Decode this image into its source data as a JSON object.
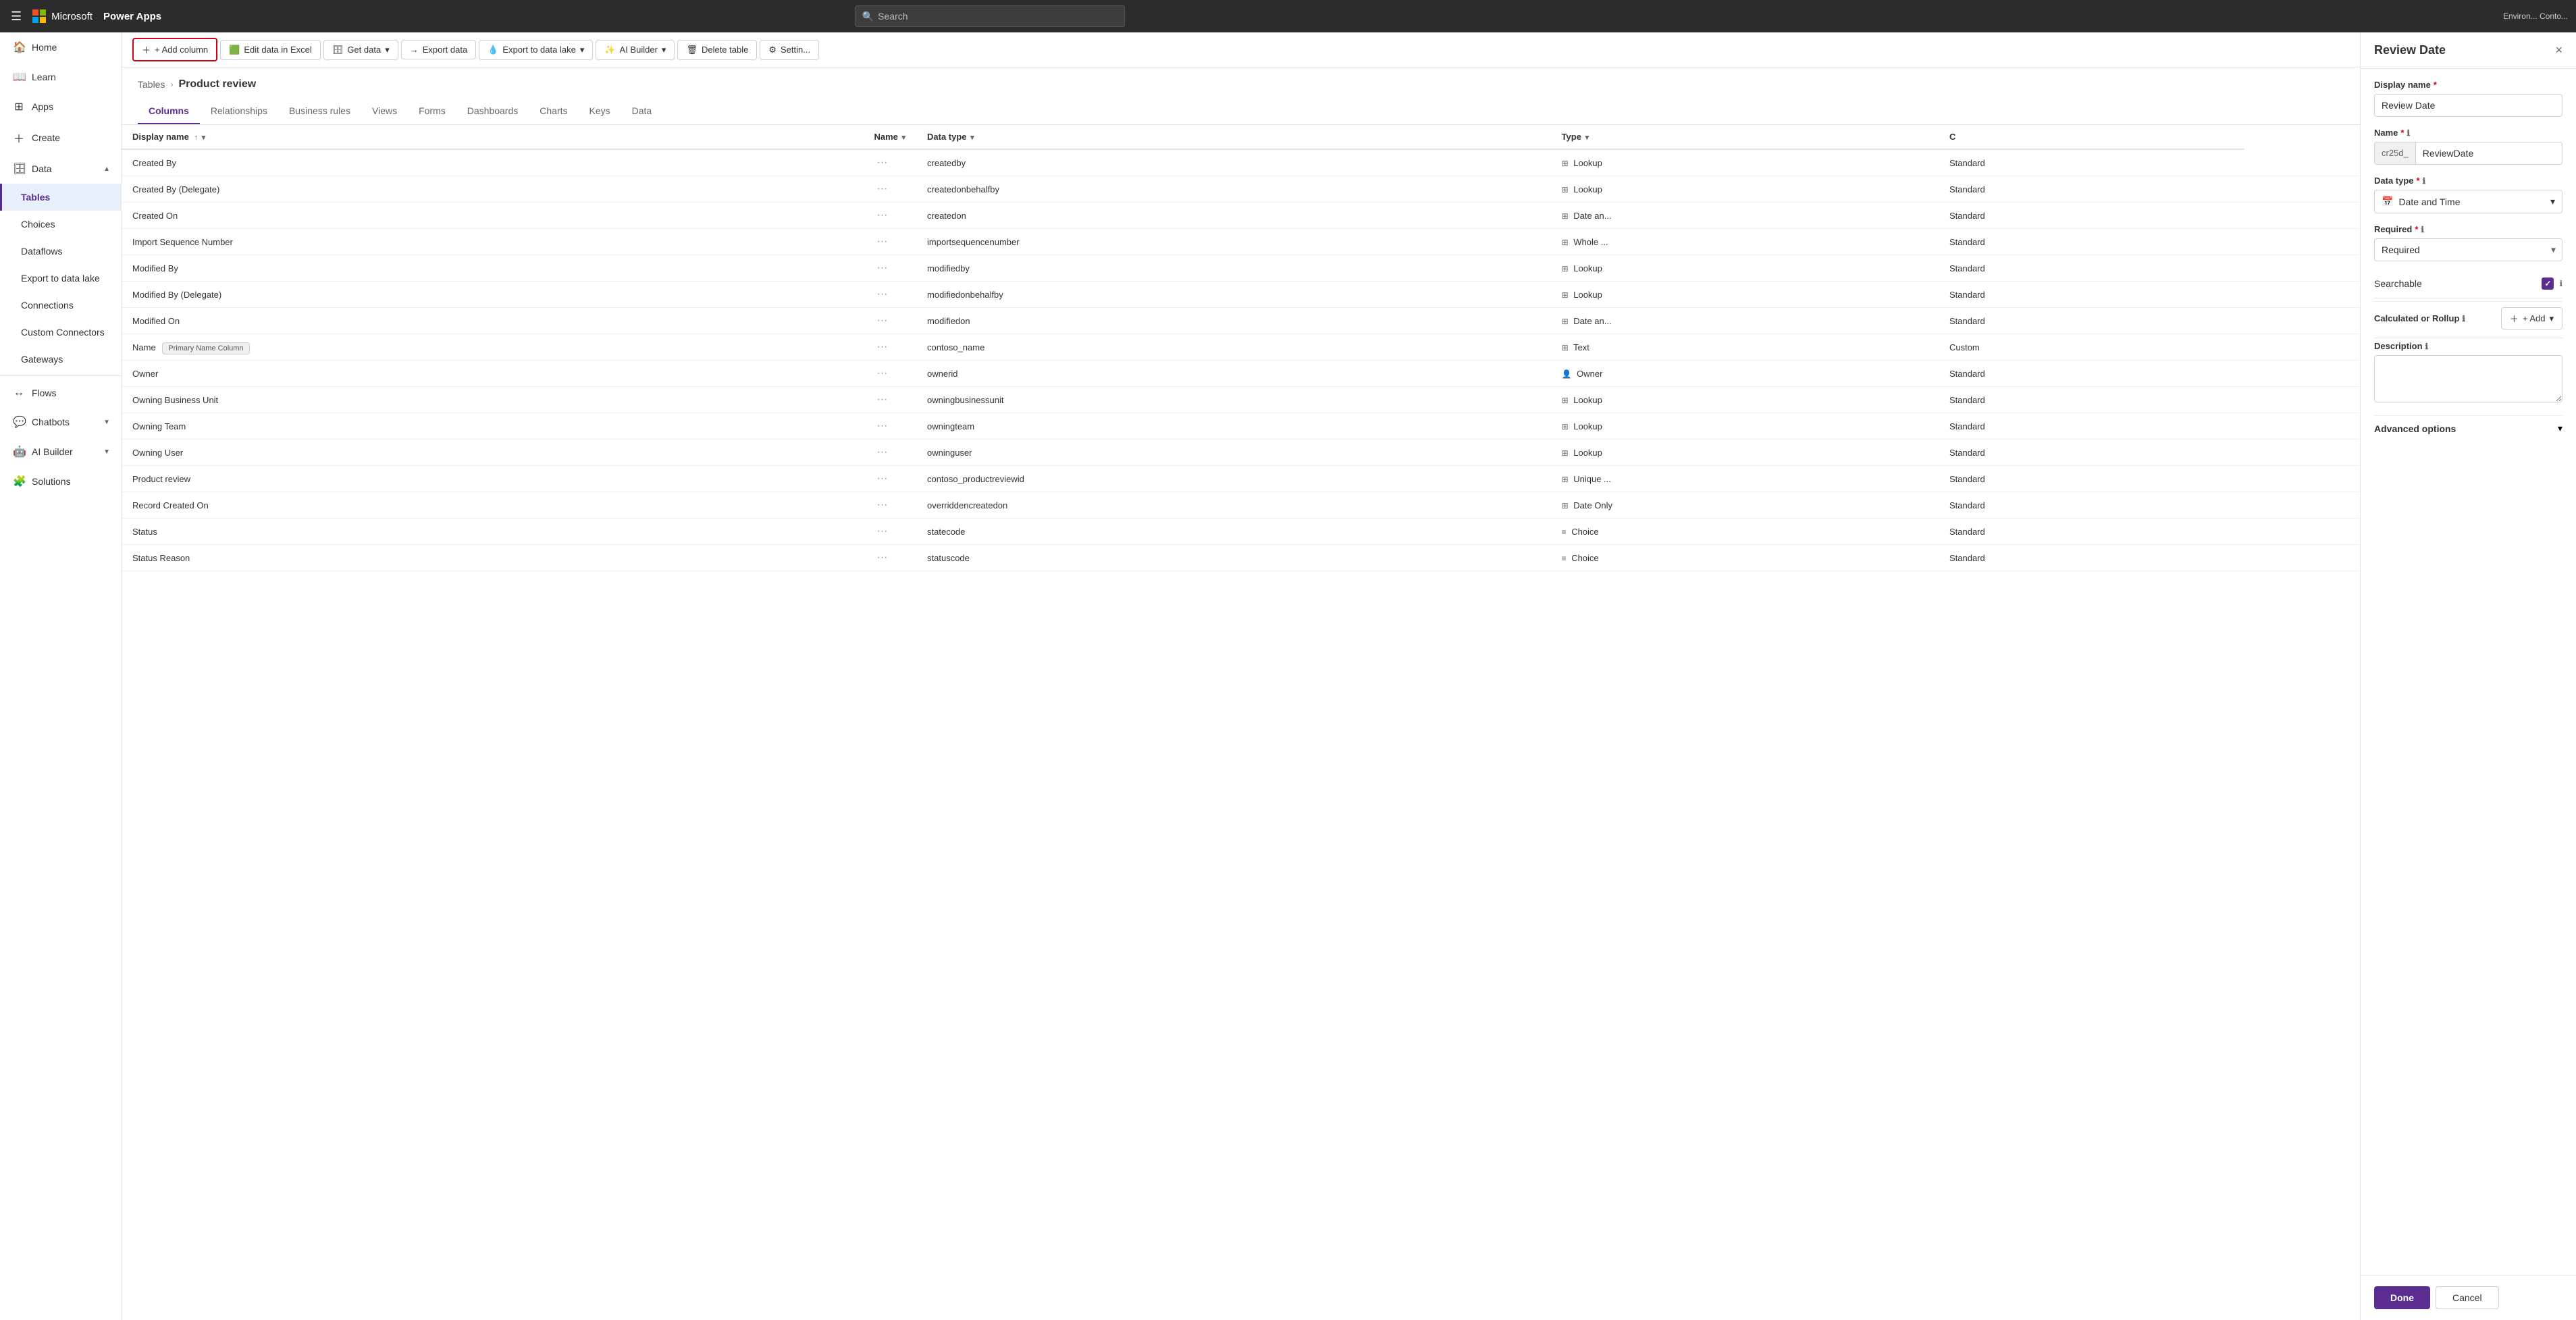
{
  "topNav": {
    "appName": "Power Apps",
    "searchPlaceholder": "Search",
    "envLabel": "Environ... Conto..."
  },
  "sidebar": {
    "items": [
      {
        "id": "home",
        "label": "Home",
        "icon": "🏠",
        "active": false
      },
      {
        "id": "learn",
        "label": "Learn",
        "icon": "📖",
        "active": false
      },
      {
        "id": "apps",
        "label": "Apps",
        "icon": "⊞",
        "active": false
      },
      {
        "id": "create",
        "label": "Create",
        "icon": "+",
        "active": false
      },
      {
        "id": "data",
        "label": "Data",
        "icon": "🗄",
        "active": false,
        "expanded": true
      },
      {
        "id": "tables",
        "label": "Tables",
        "icon": "",
        "active": true,
        "sub": true
      },
      {
        "id": "choices",
        "label": "Choices",
        "icon": "",
        "active": false,
        "sub": true
      },
      {
        "id": "dataflows",
        "label": "Dataflows",
        "icon": "",
        "active": false,
        "sub": true
      },
      {
        "id": "export",
        "label": "Export to data lake",
        "icon": "",
        "active": false,
        "sub": true
      },
      {
        "id": "connections",
        "label": "Connections",
        "icon": "",
        "active": false,
        "sub": true
      },
      {
        "id": "connectors",
        "label": "Custom Connectors",
        "icon": "",
        "active": false,
        "sub": true
      },
      {
        "id": "gateways",
        "label": "Gateways",
        "icon": "",
        "active": false,
        "sub": true
      },
      {
        "id": "flows",
        "label": "Flows",
        "icon": "↔",
        "active": false
      },
      {
        "id": "chatbots",
        "label": "Chatbots",
        "icon": "💬",
        "active": false
      },
      {
        "id": "aibuilder",
        "label": "AI Builder",
        "icon": "🤖",
        "active": false
      },
      {
        "id": "solutions",
        "label": "Solutions",
        "icon": "🧩",
        "active": false
      }
    ]
  },
  "toolbar": {
    "addColumn": "+ Add column",
    "editExcel": "Edit data in Excel",
    "getData": "Get data",
    "exportData": "Export data",
    "exportLake": "Export to data lake",
    "aiBuilder": "AI Builder",
    "deleteTable": "Delete table",
    "settings": "Settin..."
  },
  "breadcrumb": {
    "tables": "Tables",
    "current": "Product review"
  },
  "tabs": [
    {
      "id": "columns",
      "label": "Columns",
      "active": true
    },
    {
      "id": "relationships",
      "label": "Relationships",
      "active": false
    },
    {
      "id": "businessrules",
      "label": "Business rules",
      "active": false
    },
    {
      "id": "views",
      "label": "Views",
      "active": false
    },
    {
      "id": "forms",
      "label": "Forms",
      "active": false
    },
    {
      "id": "dashboards",
      "label": "Dashboards",
      "active": false
    },
    {
      "id": "charts",
      "label": "Charts",
      "active": false
    },
    {
      "id": "keys",
      "label": "Keys",
      "active": false
    },
    {
      "id": "data",
      "label": "Data",
      "active": false
    }
  ],
  "tableColumns": {
    "headers": [
      "Display name",
      "Name",
      "Data type",
      "Type",
      "C"
    ],
    "rows": [
      {
        "displayName": "Created By",
        "dots": "···",
        "name": "createdby",
        "dataType": "Lookup",
        "type": "Standard",
        "dtIcon": "⊞"
      },
      {
        "displayName": "Created By (Delegate)",
        "dots": "···",
        "name": "createdonbehalfby",
        "dataType": "Lookup",
        "type": "Standard",
        "dtIcon": "⊞"
      },
      {
        "displayName": "Created On",
        "dots": "···",
        "name": "createdon",
        "dataType": "Date an...",
        "type": "Standard",
        "dtIcon": "⊞"
      },
      {
        "displayName": "Import Sequence Number",
        "dots": "···",
        "name": "importsequencenumber",
        "dataType": "Whole ...",
        "type": "Standard",
        "dtIcon": "⊞"
      },
      {
        "displayName": "Modified By",
        "dots": "···",
        "name": "modifiedby",
        "dataType": "Lookup",
        "type": "Standard",
        "dtIcon": "⊞"
      },
      {
        "displayName": "Modified By (Delegate)",
        "dots": "···",
        "name": "modifiedonbehalfby",
        "dataType": "Lookup",
        "type": "Standard",
        "dtIcon": "⊞"
      },
      {
        "displayName": "Modified On",
        "dots": "···",
        "name": "modifiedon",
        "dataType": "Date an...",
        "type": "Standard",
        "dtIcon": "⊞"
      },
      {
        "displayName": "Name",
        "dots": "···",
        "name": "contoso_name",
        "badge": "Primary Name Column",
        "dataType": "Text",
        "type": "Custom",
        "dtIcon": "⊞"
      },
      {
        "displayName": "Owner",
        "dots": "···",
        "name": "ownerid",
        "dataType": "Owner",
        "type": "Standard",
        "dtIcon": "👤"
      },
      {
        "displayName": "Owning Business Unit",
        "dots": "···",
        "name": "owningbusinessunit",
        "dataType": "Lookup",
        "type": "Standard",
        "dtIcon": "⊞"
      },
      {
        "displayName": "Owning Team",
        "dots": "···",
        "name": "owningteam",
        "dataType": "Lookup",
        "type": "Standard",
        "dtIcon": "⊞"
      },
      {
        "displayName": "Owning User",
        "dots": "···",
        "name": "owninguser",
        "dataType": "Lookup",
        "type": "Standard",
        "dtIcon": "⊞"
      },
      {
        "displayName": "Product review",
        "dots": "···",
        "name": "contoso_productreviewid",
        "dataType": "Unique ...",
        "type": "Standard",
        "dtIcon": "⊞"
      },
      {
        "displayName": "Record Created On",
        "dots": "···",
        "name": "overriddencreatedon",
        "dataType": "Date Only",
        "type": "Standard",
        "dtIcon": "⊞"
      },
      {
        "displayName": "Status",
        "dots": "···",
        "name": "statecode",
        "dataType": "Choice",
        "type": "Standard",
        "dtIcon": "≡"
      },
      {
        "displayName": "Status Reason",
        "dots": "···",
        "name": "statuscode",
        "dataType": "Choice",
        "type": "Standard",
        "dtIcon": "≡"
      }
    ]
  },
  "panel": {
    "title": "Review Date",
    "closeLabel": "×",
    "fields": {
      "displayNameLabel": "Display name",
      "displayNameValue": "Review Date",
      "nameLabel": "Name",
      "namePrefix": "cr25d_",
      "nameValue": "ReviewDate",
      "dataTypeLabel": "Data type",
      "dataTypeValue": "Date and Time",
      "dataTypeIcon": "📅",
      "requiredLabel": "Required",
      "requiredValue": "Required",
      "searchableLabel": "Searchable",
      "searchableChecked": true,
      "calcLabel": "Calculated or Rollup",
      "addBtnLabel": "+ Add",
      "descLabel": "Description",
      "descPlaceholder": "",
      "advLabel": "Advanced options"
    },
    "footer": {
      "doneLabel": "Done",
      "cancelLabel": "Cancel"
    }
  }
}
